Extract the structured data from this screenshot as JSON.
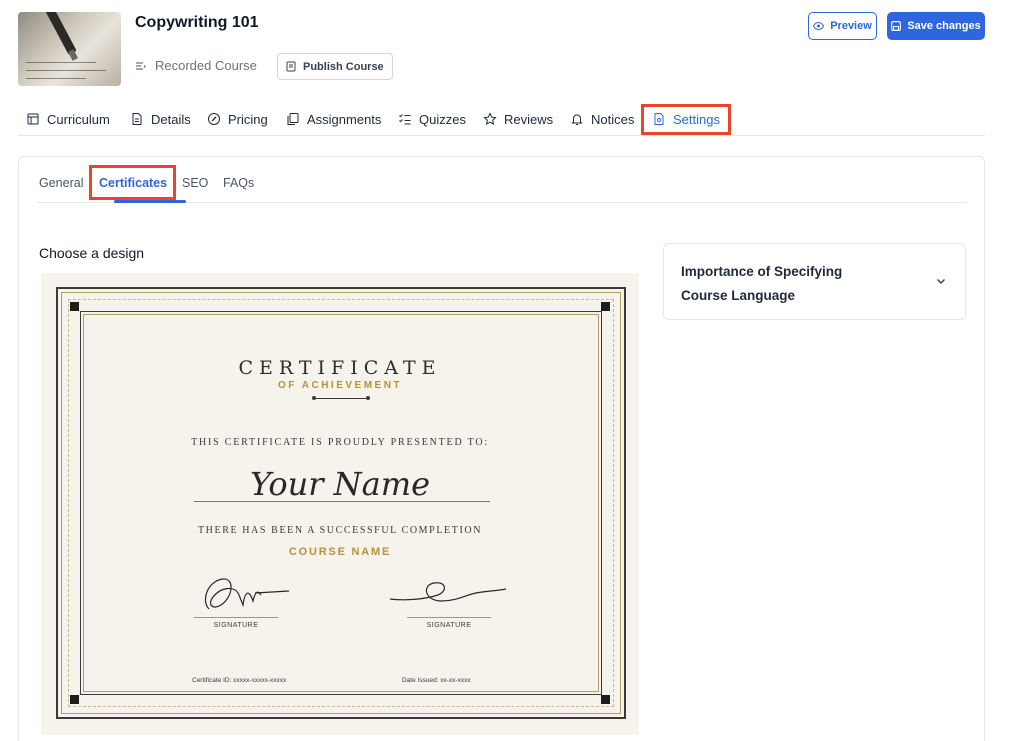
{
  "course": {
    "title": "Copywriting 101",
    "type_label": "Recorded Course",
    "publish_label": "Publish Course"
  },
  "header_actions": {
    "preview_label": "Preview",
    "save_label": "Save changes"
  },
  "main_tabs": [
    {
      "label": "Curriculum",
      "icon": "curriculum-icon"
    },
    {
      "label": "Details",
      "icon": "document-icon"
    },
    {
      "label": "Pricing",
      "icon": "pricing-icon"
    },
    {
      "label": "Assignments",
      "icon": "copy-icon"
    },
    {
      "label": "Quizzes",
      "icon": "list-check-icon"
    },
    {
      "label": "Reviews",
      "icon": "star-icon"
    },
    {
      "label": "Notices",
      "icon": "bell-icon"
    },
    {
      "label": "Settings",
      "icon": "settings-file-icon",
      "active": true
    }
  ],
  "settings_tabs": [
    {
      "label": "General"
    },
    {
      "label": "Certificates",
      "active": true
    },
    {
      "label": "SEO"
    },
    {
      "label": "FAQs"
    }
  ],
  "certificate_section": {
    "heading": "Choose a design"
  },
  "certificate": {
    "title": "CERTIFICATE",
    "subtitle": "OF ACHIEVEMENT",
    "presented_to": "THIS CERTIFICATE IS PROUDLY PRESENTED TO:",
    "name": "Your Name",
    "completion": "THERE HAS BEEN A SUCCESSFUL COMPLETION",
    "course_name": "COURSE NAME",
    "signature_left": "SIGNATURE",
    "signature_right": "SIGNATURE",
    "certificate_id": "Certificate ID: xxxxx-xxxxx-xxxxx",
    "date_issued": "Date Issued: xx-xx-xxxx"
  },
  "accordion": {
    "title": "Importance of Specifying Course Language"
  },
  "colors": {
    "accent": "#2f66e0",
    "highlight": "#e8452c",
    "gold": "#b5923e"
  }
}
